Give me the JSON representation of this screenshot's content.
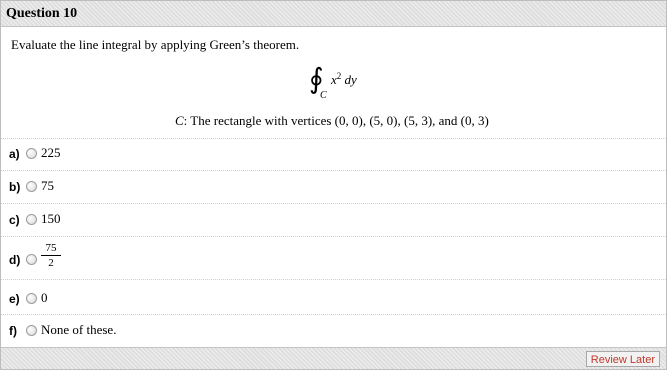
{
  "question": {
    "title": "Question 10",
    "prompt": "Evaluate the line integral by applying Green’s theorem.",
    "integral": {
      "sign": "∮",
      "subscript": "C",
      "integrand_base": "x",
      "integrand_exp": "2",
      "integrand_tail": " dy"
    },
    "curve": {
      "var": "C",
      "text": ":  The rectangle with vertices (0, 0), (5, 0), (5, 3), and (0, 3)"
    }
  },
  "options": [
    {
      "letter": "a)",
      "value": "225"
    },
    {
      "letter": "b)",
      "value": "75"
    },
    {
      "letter": "c)",
      "value": "150"
    },
    {
      "letter": "d)",
      "numerator": "75",
      "denominator": "2"
    },
    {
      "letter": "e)",
      "value": "0"
    },
    {
      "letter": "f)",
      "value": "None of these."
    }
  ],
  "footer": {
    "review_label": "Review Later",
    "review_color": "#c0392b"
  }
}
